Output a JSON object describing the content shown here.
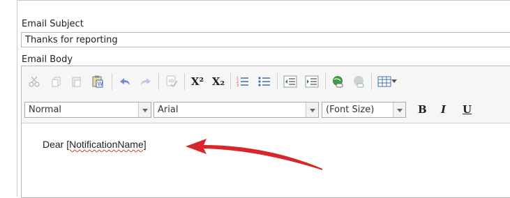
{
  "form": {
    "subject_label": "Email Subject",
    "subject_value": "Thanks for reporting",
    "body_label": "Email Body"
  },
  "editor": {
    "toolbar": {
      "superscript_label": "X²",
      "subscript_label": "X₂",
      "bold_label": "B",
      "italic_label": "I",
      "underline_label": "U"
    },
    "style_dropdown": "Normal",
    "font_dropdown": "Arial",
    "size_dropdown": "(Font Size)",
    "body_text_prefix": "Dear ",
    "body_placeholder": "[NotificationName]"
  },
  "colors": {
    "annotation_arrow": "#d9262b",
    "spellcheck_underline": "#d23a3a"
  },
  "icons": [
    "cut-icon",
    "copy-icon",
    "paste-icon",
    "paste-word-icon",
    "undo-icon",
    "redo-icon",
    "spellcheck-icon",
    "superscript-icon",
    "subscript-icon",
    "ordered-list-icon",
    "unordered-list-icon",
    "outdent-icon",
    "indent-icon",
    "insert-link-icon",
    "remove-link-icon",
    "insert-table-icon"
  ]
}
